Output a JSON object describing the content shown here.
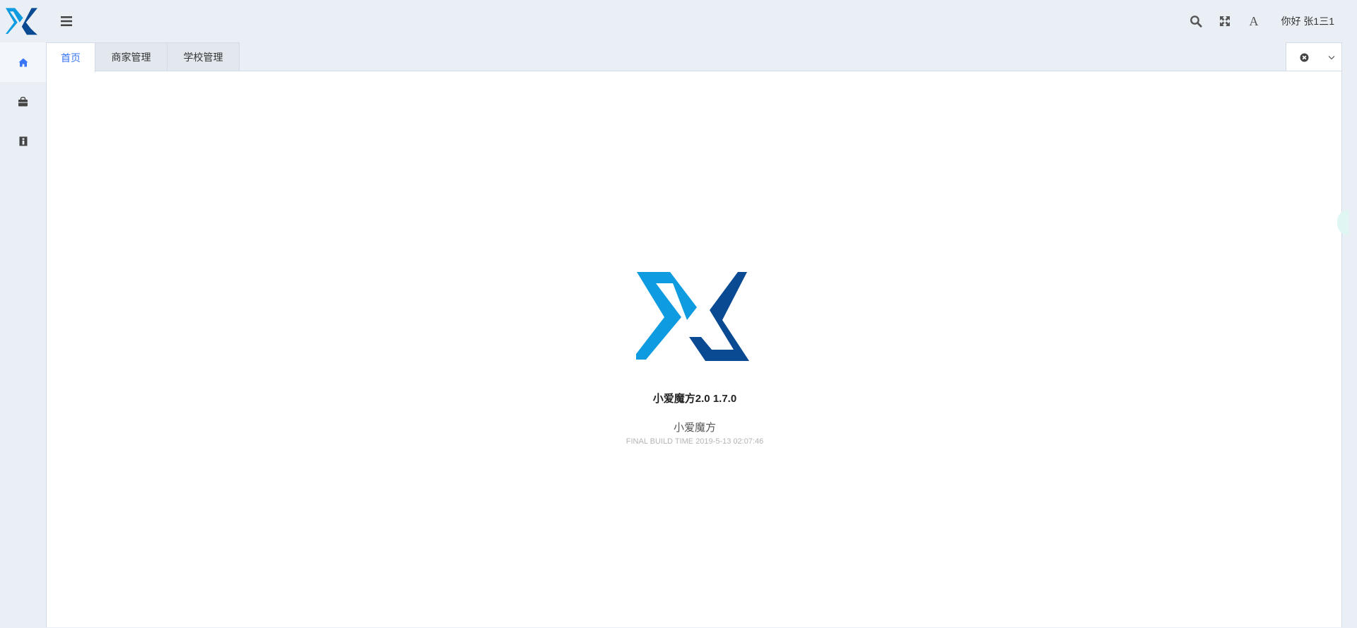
{
  "header": {
    "greeting": "你好 张1三1",
    "icons": [
      "search-icon",
      "fullscreen-icon",
      "font-size-icon"
    ],
    "font_icon_glyph": "A"
  },
  "sidebar": {
    "items": [
      {
        "icon": "home-icon",
        "active": true
      },
      {
        "icon": "shopping-bag-icon",
        "active": false
      },
      {
        "icon": "id-card-icon",
        "active": false
      }
    ]
  },
  "tabs": [
    {
      "label": "首页",
      "active": true
    },
    {
      "label": "商家管理",
      "active": false
    },
    {
      "label": "学校管理",
      "active": false
    }
  ],
  "welcome": {
    "version_title": "小爱魔方2.0 1.7.0",
    "app_name": "小爱魔方",
    "build_time": "FINAL BUILD TIME 2019-5-13 02:07:46"
  },
  "colors": {
    "accent": "#3875f6",
    "logo_light": "#0e9be0",
    "logo_dark": "#0a4a92",
    "background": "#eaeff6"
  }
}
